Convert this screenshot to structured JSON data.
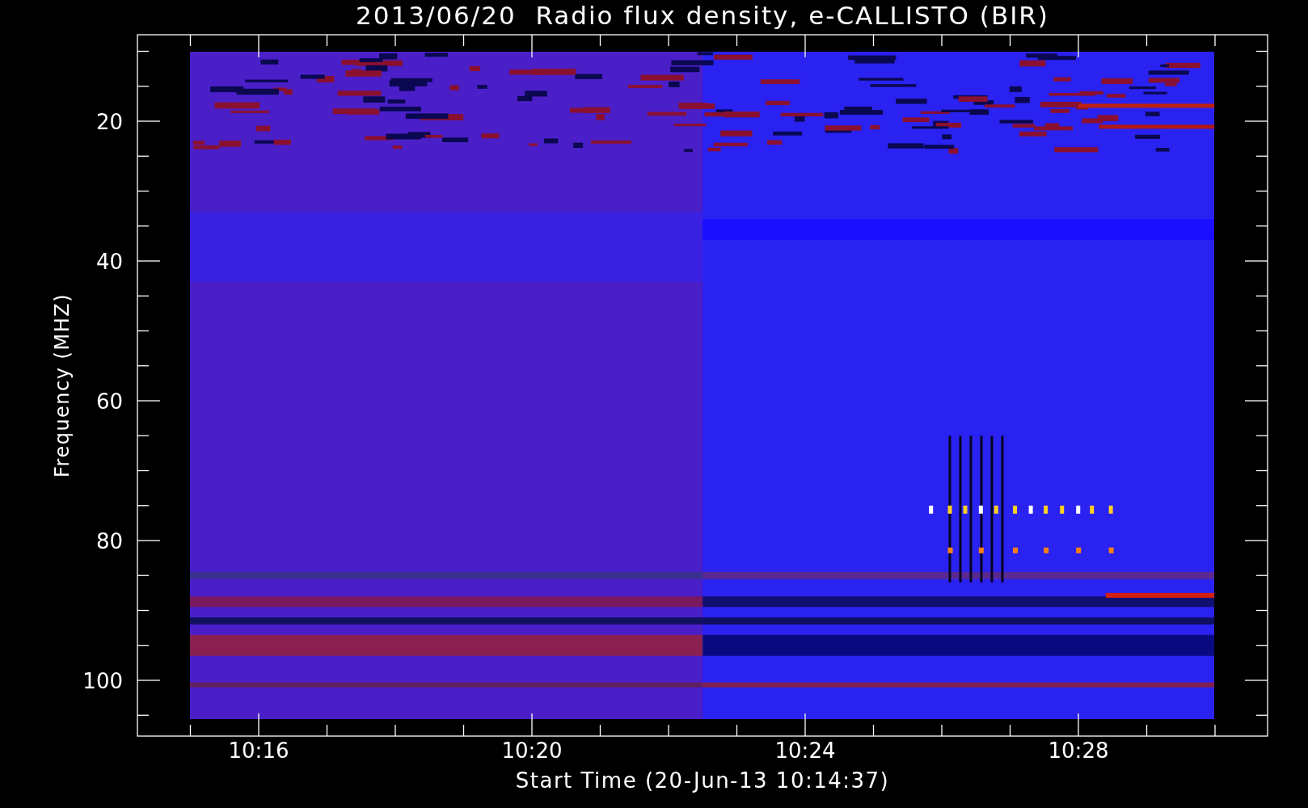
{
  "title": "2013/06/20  Radio flux density, e-CALLISTO (BIR)",
  "y_axis": {
    "label": "Frequency (MHZ)",
    "ticks": [
      "20",
      "40",
      "60",
      "80",
      "100"
    ]
  },
  "x_axis": {
    "label": "Start Time (20-Jun-13 10:14:37)",
    "ticks": [
      "10:16",
      "10:20",
      "10:24",
      "10:28"
    ]
  }
}
